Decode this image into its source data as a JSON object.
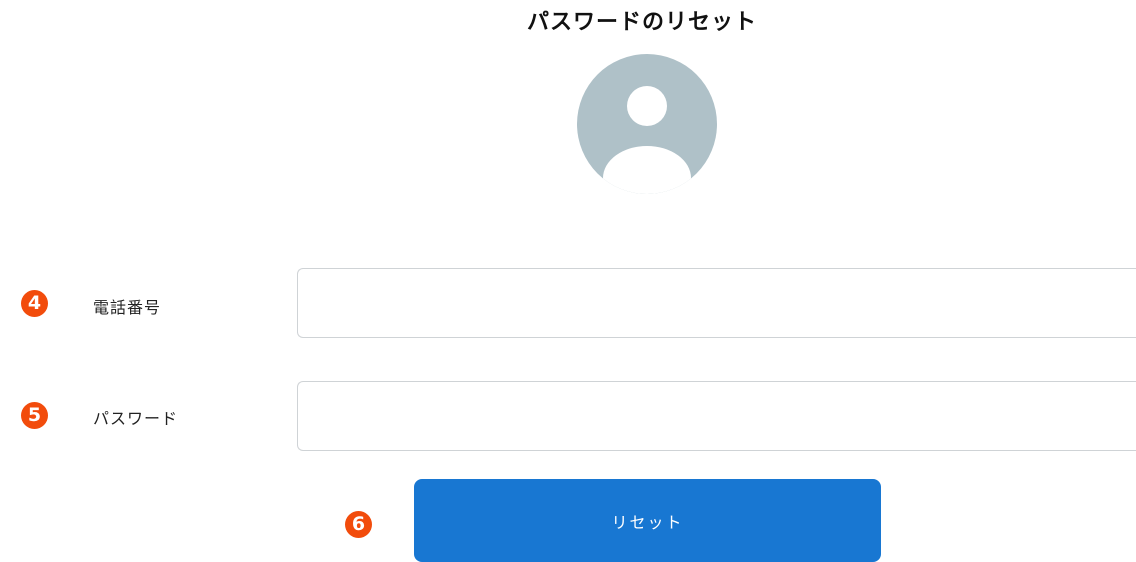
{
  "page": {
    "title": "パスワードのリセット"
  },
  "avatar": {
    "icon": "user-avatar-icon",
    "background_color": "#afc1c8",
    "figure_color": "#ffffff"
  },
  "form": {
    "phone": {
      "step_marker": "4",
      "label": "電話番号",
      "value": "",
      "placeholder": ""
    },
    "password": {
      "step_marker": "5",
      "label": "パスワード",
      "value": "",
      "placeholder": ""
    }
  },
  "reset_button": {
    "step_marker": "6",
    "label": "リセット",
    "color": "#1877d2"
  },
  "marker_color": "#f24c0c"
}
